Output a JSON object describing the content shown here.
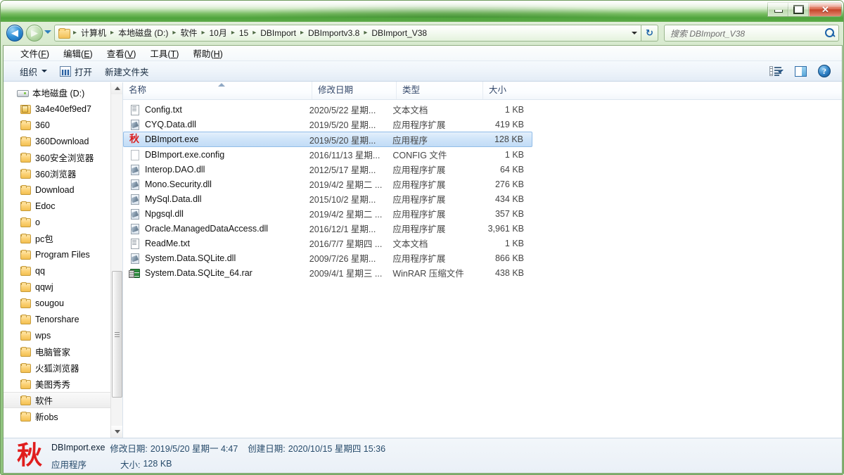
{
  "window": {
    "minimize_label": "最小化",
    "maximize_label": "最大化",
    "close_label": "✕"
  },
  "nav": {
    "back_label": "◀",
    "forward_label": "▶",
    "recent_pages_label": "最近浏览的位置",
    "refresh_label": "↻",
    "breadcrumbs": [
      "计算机",
      "本地磁盘 (D:)",
      "软件",
      "10月",
      "15",
      "DBImport",
      "DBImportv3.8",
      "DBImport_V38"
    ],
    "separator": "▸"
  },
  "search": {
    "placeholder": "搜索 DBImport_V38",
    "icon": "search-icon"
  },
  "menubar": {
    "items": [
      {
        "text": "文件",
        "key": "F"
      },
      {
        "text": "编辑",
        "key": "E"
      },
      {
        "text": "查看",
        "key": "V"
      },
      {
        "text": "工具",
        "key": "T"
      },
      {
        "text": "帮助",
        "key": "H"
      }
    ]
  },
  "toolbar": {
    "organize_label": "组织",
    "open_label": "打开",
    "new_folder_label": "新建文件夹",
    "view_icon": "list-view-icon",
    "preview_pane_icon": "preview-pane-icon",
    "help_icon": "help-icon",
    "help_glyph": "?"
  },
  "navpane": {
    "root": {
      "label": "本地磁盘 (D:)",
      "icon": "drive-icon"
    },
    "items": [
      {
        "label": "3a4e40ef9ed7",
        "icon": "folder-lock-icon",
        "selected": false
      },
      {
        "label": "360",
        "icon": "folder-icon",
        "selected": false
      },
      {
        "label": "360Download",
        "icon": "folder-icon",
        "selected": false
      },
      {
        "label": "360安全浏览器",
        "icon": "folder-icon",
        "selected": false
      },
      {
        "label": "360浏览器",
        "icon": "folder-icon",
        "selected": false
      },
      {
        "label": "Download",
        "icon": "folder-icon",
        "selected": false
      },
      {
        "label": "Edoc",
        "icon": "folder-icon",
        "selected": false
      },
      {
        "label": "o",
        "icon": "folder-icon",
        "selected": false
      },
      {
        "label": "pc包",
        "icon": "folder-icon",
        "selected": false
      },
      {
        "label": "Program Files",
        "icon": "folder-icon",
        "selected": false
      },
      {
        "label": "qq",
        "icon": "folder-icon",
        "selected": false
      },
      {
        "label": "qqwj",
        "icon": "folder-icon",
        "selected": false
      },
      {
        "label": "sougou",
        "icon": "folder-icon",
        "selected": false
      },
      {
        "label": "Tenorshare",
        "icon": "folder-icon",
        "selected": false
      },
      {
        "label": "wps",
        "icon": "folder-icon",
        "selected": false
      },
      {
        "label": "电脑管家",
        "icon": "folder-icon",
        "selected": false
      },
      {
        "label": "火狐浏览器",
        "icon": "folder-icon",
        "selected": false
      },
      {
        "label": "美图秀秀",
        "icon": "folder-icon",
        "selected": false
      },
      {
        "label": "软件",
        "icon": "folder-icon",
        "selected": true
      },
      {
        "label": "新obs",
        "icon": "folder-icon",
        "selected": false
      }
    ]
  },
  "filelist": {
    "columns": [
      "名称",
      "修改日期",
      "类型",
      "大小"
    ],
    "sort_column": "名称",
    "sort_direction": "asc",
    "rows": [
      {
        "name": "Config.txt",
        "date": "2020/5/22 星期...",
        "type": "文本文档",
        "size": "1 KB",
        "icon": "text-file-icon",
        "selected": false
      },
      {
        "name": "CYQ.Data.dll",
        "date": "2019/5/20 星期...",
        "type": "应用程序扩展",
        "size": "419 KB",
        "icon": "dll-file-icon",
        "selected": false
      },
      {
        "name": "DBImport.exe",
        "date": "2019/5/20 星期...",
        "type": "应用程序",
        "size": "128 KB",
        "icon": "exe-file-icon",
        "icon_glyph": "秋",
        "selected": true
      },
      {
        "name": "DBImport.exe.config",
        "date": "2016/11/13 星期...",
        "type": "CONFIG 文件",
        "size": "1 KB",
        "icon": "blank-file-icon",
        "selected": false
      },
      {
        "name": "Interop.DAO.dll",
        "date": "2012/5/17 星期...",
        "type": "应用程序扩展",
        "size": "64 KB",
        "icon": "dll-file-icon",
        "selected": false
      },
      {
        "name": "Mono.Security.dll",
        "date": "2019/4/2 星期二 ...",
        "type": "应用程序扩展",
        "size": "276 KB",
        "icon": "dll-file-icon",
        "selected": false
      },
      {
        "name": "MySql.Data.dll",
        "date": "2015/10/2 星期...",
        "type": "应用程序扩展",
        "size": "434 KB",
        "icon": "dll-file-icon",
        "selected": false
      },
      {
        "name": "Npgsql.dll",
        "date": "2019/4/2 星期二 ...",
        "type": "应用程序扩展",
        "size": "357 KB",
        "icon": "dll-file-icon",
        "selected": false
      },
      {
        "name": "Oracle.ManagedDataAccess.dll",
        "date": "2016/12/1 星期...",
        "type": "应用程序扩展",
        "size": "3,961 KB",
        "icon": "dll-file-icon",
        "selected": false
      },
      {
        "name": "ReadMe.txt",
        "date": "2016/7/7 星期四 ...",
        "type": "文本文档",
        "size": "1 KB",
        "icon": "text-file-icon",
        "selected": false
      },
      {
        "name": "System.Data.SQLite.dll",
        "date": "2009/7/26 星期...",
        "type": "应用程序扩展",
        "size": "866 KB",
        "icon": "dll-file-icon",
        "selected": false
      },
      {
        "name": "System.Data.SQLite_64.rar",
        "date": "2009/4/1 星期三 ...",
        "type": "WinRAR 压缩文件",
        "size": "438 KB",
        "icon": "rar-file-icon",
        "selected": false
      }
    ]
  },
  "details": {
    "icon_glyph": "秋",
    "file_name": "DBImport.exe",
    "modified_label": "修改日期:",
    "modified_value": "2019/5/20 星期一 4:47",
    "created_label": "创建日期:",
    "created_value": "2020/10/15 星期四 15:36",
    "file_type": "应用程序",
    "size_label": "大小:",
    "size_value": "128 KB"
  },
  "colors": {
    "title_green": "#79bd63",
    "close_red": "#c6442a",
    "selection_blue": "#cfe4f9",
    "selection_border": "#92bde8",
    "accent_blue": "#1c63a8",
    "exe_icon_red": "#d91d1d"
  }
}
